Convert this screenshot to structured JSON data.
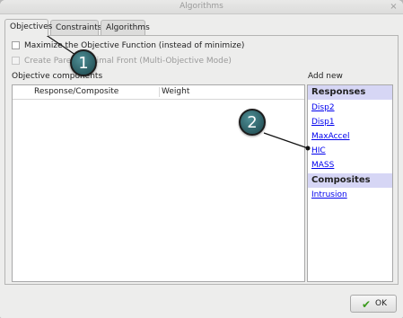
{
  "window": {
    "title": "Algorithms",
    "close_glyph": "×"
  },
  "tabs": [
    {
      "label": "Objectives",
      "active": true
    },
    {
      "label": "Constraints",
      "active": false
    },
    {
      "label": "Algorithms",
      "active": false
    }
  ],
  "options": {
    "maximize": {
      "label": "Maximize the Objective Function (instead of minimize)",
      "checked": false,
      "enabled": true
    },
    "pareto": {
      "label": "Create Pareto Optimal Front (Multi-Objective Mode)",
      "checked": false,
      "enabled": false
    }
  },
  "objective_components": {
    "label": "Objective components",
    "columns": [
      "Response/Composite",
      "Weight"
    ]
  },
  "add_new": {
    "label": "Add new",
    "groups": [
      {
        "heading": "Responses",
        "items": [
          "Disp2",
          "Disp1",
          "MaxAccel",
          "HIC",
          "MASS"
        ]
      },
      {
        "heading": "Composites",
        "items": [
          "Intrusion"
        ]
      }
    ]
  },
  "ok_button": {
    "label": "OK",
    "icon": "checkmark-icon"
  },
  "callouts": [
    {
      "number": "1",
      "target": "Objectives tab"
    },
    {
      "number": "2",
      "target": "HIC response link"
    }
  ],
  "colors": {
    "group_header_bg": "#d6d6f5",
    "link": "#0000ee",
    "marker_fill": "#3b757c"
  }
}
